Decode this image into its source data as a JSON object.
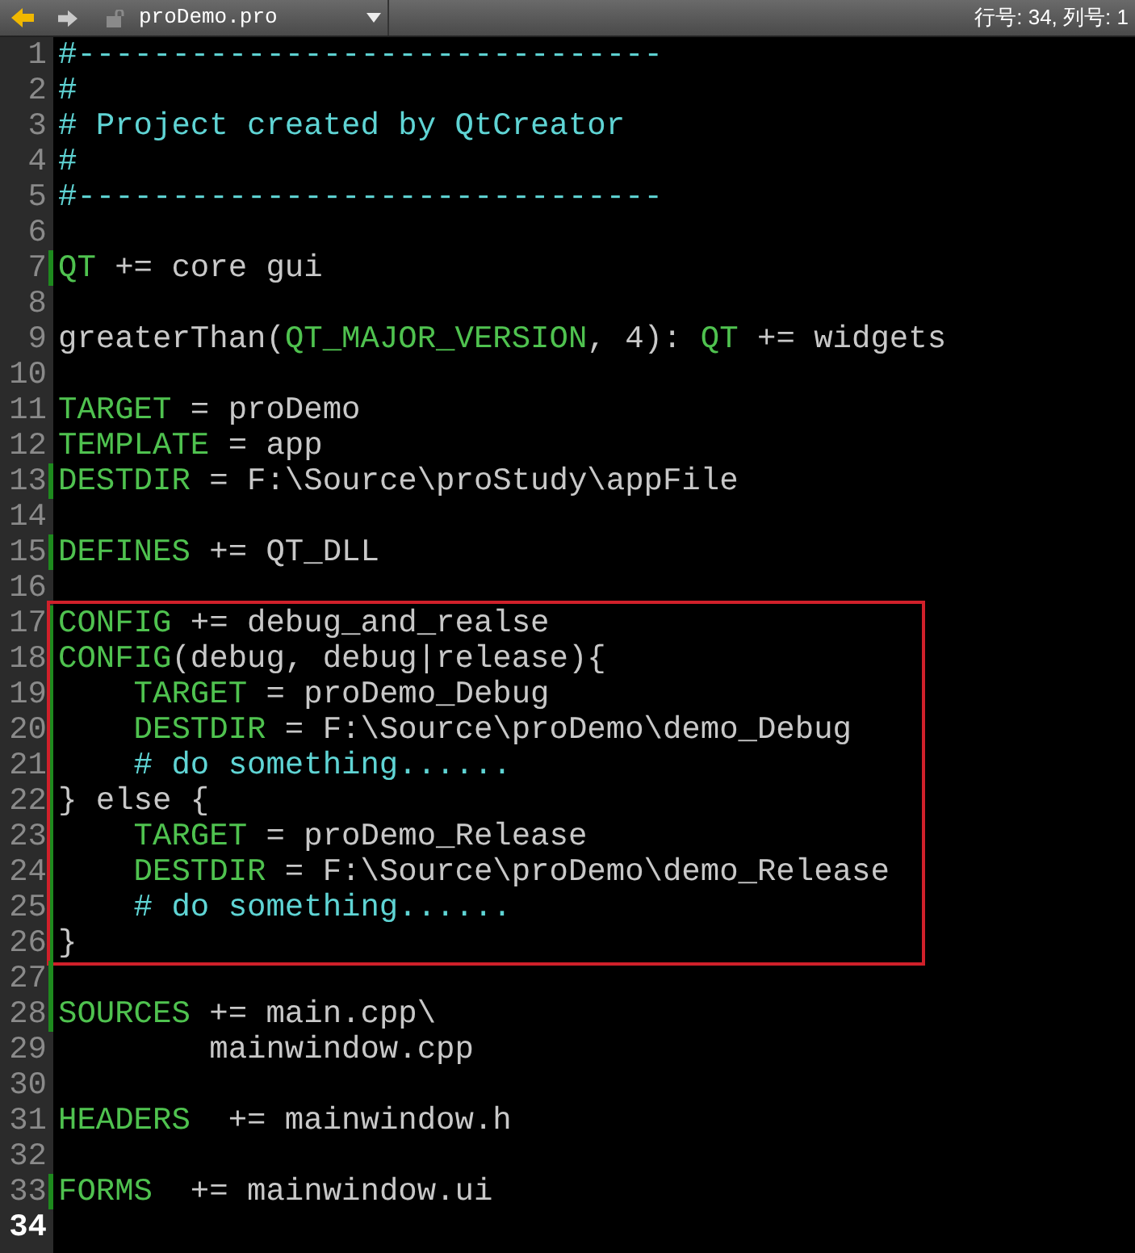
{
  "toolbar": {
    "file_name": "proDemo.pro",
    "status": "行号: 34, 列号: 1"
  },
  "sections": [
    {
      "framed": false,
      "lines": [
        {
          "number": "1",
          "changed": false,
          "current": false,
          "segments": [
            {
              "kind": "comment",
              "text": "#-------------------------------"
            }
          ]
        },
        {
          "number": "2",
          "changed": false,
          "current": false,
          "segments": [
            {
              "kind": "comment",
              "text": "#"
            }
          ]
        },
        {
          "number": "3",
          "changed": false,
          "current": false,
          "segments": [
            {
              "kind": "comment",
              "text": "# Project created by QtCreator"
            }
          ]
        },
        {
          "number": "4",
          "changed": false,
          "current": false,
          "segments": [
            {
              "kind": "comment",
              "text": "#"
            }
          ]
        },
        {
          "number": "5",
          "changed": false,
          "current": false,
          "segments": [
            {
              "kind": "comment",
              "text": "#-------------------------------"
            }
          ]
        },
        {
          "number": "6",
          "changed": false,
          "current": false
        },
        {
          "number": "7",
          "changed": true,
          "current": false,
          "segments": [
            {
              "kind": "keyword",
              "text": "QT"
            },
            {
              "kind": "plain",
              "text": " += core gui"
            }
          ]
        },
        {
          "number": "8",
          "changed": false,
          "current": false
        },
        {
          "number": "9",
          "changed": false,
          "current": false,
          "segments": [
            {
              "kind": "plain",
              "text": "greaterThan("
            },
            {
              "kind": "keyword",
              "text": "QT_MAJOR_VERSION"
            },
            {
              "kind": "plain",
              "text": ", 4): "
            },
            {
              "kind": "keyword",
              "text": "QT"
            },
            {
              "kind": "plain",
              "text": " += widgets"
            }
          ]
        },
        {
          "number": "10",
          "changed": false,
          "current": false
        },
        {
          "number": "11",
          "changed": false,
          "current": false,
          "segments": [
            {
              "kind": "keyword",
              "text": "TARGET"
            },
            {
              "kind": "plain",
              "text": " = proDemo"
            }
          ]
        },
        {
          "number": "12",
          "changed": false,
          "current": false,
          "segments": [
            {
              "kind": "keyword",
              "text": "TEMPLATE"
            },
            {
              "kind": "plain",
              "text": " = app"
            }
          ]
        },
        {
          "number": "13",
          "changed": true,
          "current": false,
          "segments": [
            {
              "kind": "keyword",
              "text": "DESTDIR"
            },
            {
              "kind": "plain",
              "text": " = F:\\Source\\proStudy\\appFile"
            }
          ]
        },
        {
          "number": "14",
          "changed": false,
          "current": false
        },
        {
          "number": "15",
          "changed": true,
          "current": false,
          "segments": [
            {
              "kind": "keyword",
              "text": "DEFINES"
            },
            {
              "kind": "plain",
              "text": " += QT_DLL"
            }
          ]
        },
        {
          "number": "16",
          "changed": false,
          "current": false
        }
      ]
    },
    {
      "framed": true,
      "lines": [
        {
          "number": "17",
          "changed": true,
          "current": false,
          "segments": [
            {
              "kind": "keyword",
              "text": "CONFIG"
            },
            {
              "kind": "plain",
              "text": " += debug_and_realse"
            }
          ]
        },
        {
          "number": "18",
          "changed": true,
          "current": false,
          "segments": [
            {
              "kind": "keyword",
              "text": "CONFIG"
            },
            {
              "kind": "plain",
              "text": "(debug, debug|release){"
            }
          ]
        },
        {
          "number": "19",
          "changed": true,
          "current": false,
          "segments": [
            {
              "kind": "keyword",
              "text": "    TARGET"
            },
            {
              "kind": "plain",
              "text": " = proDemo_Debug"
            }
          ]
        },
        {
          "number": "20",
          "changed": true,
          "current": false,
          "segments": [
            {
              "kind": "keyword",
              "text": "    DESTDIR"
            },
            {
              "kind": "plain",
              "text": " = F:\\Source\\proDemo\\demo_Debug"
            }
          ]
        },
        {
          "number": "21",
          "changed": true,
          "current": false,
          "segments": [
            {
              "kind": "comment",
              "text": "    # do something......"
            }
          ]
        },
        {
          "number": "22",
          "changed": true,
          "current": false,
          "segments": [
            {
              "kind": "plain",
              "text": "} else {"
            }
          ]
        },
        {
          "number": "23",
          "changed": true,
          "current": false,
          "segments": [
            {
              "kind": "keyword",
              "text": "    TARGET"
            },
            {
              "kind": "plain",
              "text": " = proDemo_Release"
            }
          ]
        },
        {
          "number": "24",
          "changed": true,
          "current": false,
          "segments": [
            {
              "kind": "keyword",
              "text": "    DESTDIR"
            },
            {
              "kind": "plain",
              "text": " = F:\\Source\\proDemo\\demo_Release"
            }
          ]
        },
        {
          "number": "25",
          "changed": true,
          "current": false,
          "segments": [
            {
              "kind": "comment",
              "text": "    # do something......"
            }
          ]
        },
        {
          "number": "26",
          "changed": true,
          "current": false,
          "segments": [
            {
              "kind": "plain",
              "text": "}"
            }
          ]
        }
      ]
    },
    {
      "framed": false,
      "lines": [
        {
          "number": "27",
          "changed": true,
          "current": false
        },
        {
          "number": "28",
          "changed": true,
          "current": false,
          "segments": [
            {
              "kind": "keyword",
              "text": "SOURCES"
            },
            {
              "kind": "plain",
              "text": " += main.cpp\\"
            }
          ]
        },
        {
          "number": "29",
          "changed": false,
          "current": false,
          "segments": [
            {
              "kind": "plain",
              "text": "        mainwindow.cpp"
            }
          ]
        },
        {
          "number": "30",
          "changed": false,
          "current": false
        },
        {
          "number": "31",
          "changed": false,
          "current": false,
          "segments": [
            {
              "kind": "keyword",
              "text": "HEADERS"
            },
            {
              "kind": "plain",
              "text": "  += mainwindow.h"
            }
          ]
        },
        {
          "number": "32",
          "changed": false,
          "current": false
        },
        {
          "number": "33",
          "changed": true,
          "current": false,
          "segments": [
            {
              "kind": "keyword",
              "text": "FORMS"
            },
            {
              "kind": "plain",
              "text": "  += mainwindow.ui"
            }
          ]
        },
        {
          "number": "34",
          "changed": false,
          "current": true
        }
      ]
    }
  ]
}
